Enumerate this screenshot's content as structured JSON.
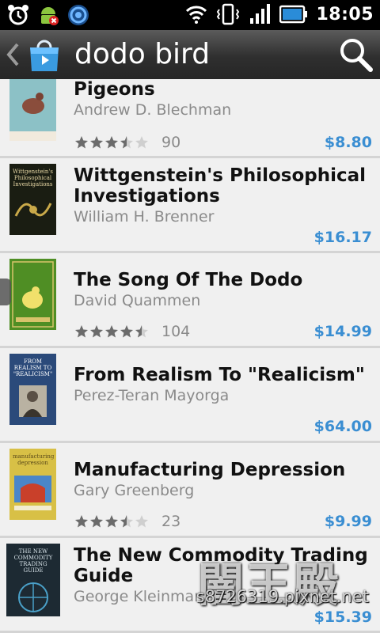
{
  "status_bar": {
    "time": "18:05",
    "left_icons": [
      "alarm-clock-icon",
      "android-warning-icon",
      "sync-icon"
    ],
    "right_icons": [
      "wifi-icon",
      "vibrate-icon",
      "signal-icon",
      "battery-icon"
    ]
  },
  "action_bar": {
    "title": "dodo bird",
    "app_icon": "play-store-bag-icon",
    "search_icon": "search-icon"
  },
  "books": [
    {
      "title": "Pigeons",
      "author": "Andrew D. Blechman",
      "rating": 3.5,
      "rating_count": "90",
      "price": "$8.80",
      "cover_bg": "#7fb6be"
    },
    {
      "title": "Wittgenstein's Philosophical Investigations",
      "author": "William H. Brenner",
      "price": "$16.17",
      "cover_bg": "#1a1d12",
      "cover_text": "Wittgenstein's Philosophical Investigations"
    },
    {
      "title": "The Song Of The Dodo",
      "author": "David Quammen",
      "rating": 4.5,
      "rating_count": "104",
      "price": "$14.99",
      "cover_bg": "#5e9a2a"
    },
    {
      "title": "From Realism To \"Realicism\"",
      "author": "Perez-Teran Mayorga",
      "price": "$64.00",
      "cover_bg": "#2b4a7a",
      "cover_text": "FROM REALISM TO \"REALICISM\""
    },
    {
      "title": "Manufacturing Depression",
      "author": "Gary Greenberg",
      "rating": 3.5,
      "rating_count": "23",
      "price": "$9.99",
      "cover_bg": "#d8c046",
      "cover_text": "manufacturing depression"
    },
    {
      "title": "The New Commodity Trading Guide",
      "author": "George Kleinman",
      "price": "$15.39",
      "cover_bg": "#1d2a33",
      "cover_text": "THE NEW COMMODITY TRADING GUIDE"
    }
  ],
  "watermark": {
    "text": "闇王殿",
    "url": "s8726319.pixnet.net"
  }
}
